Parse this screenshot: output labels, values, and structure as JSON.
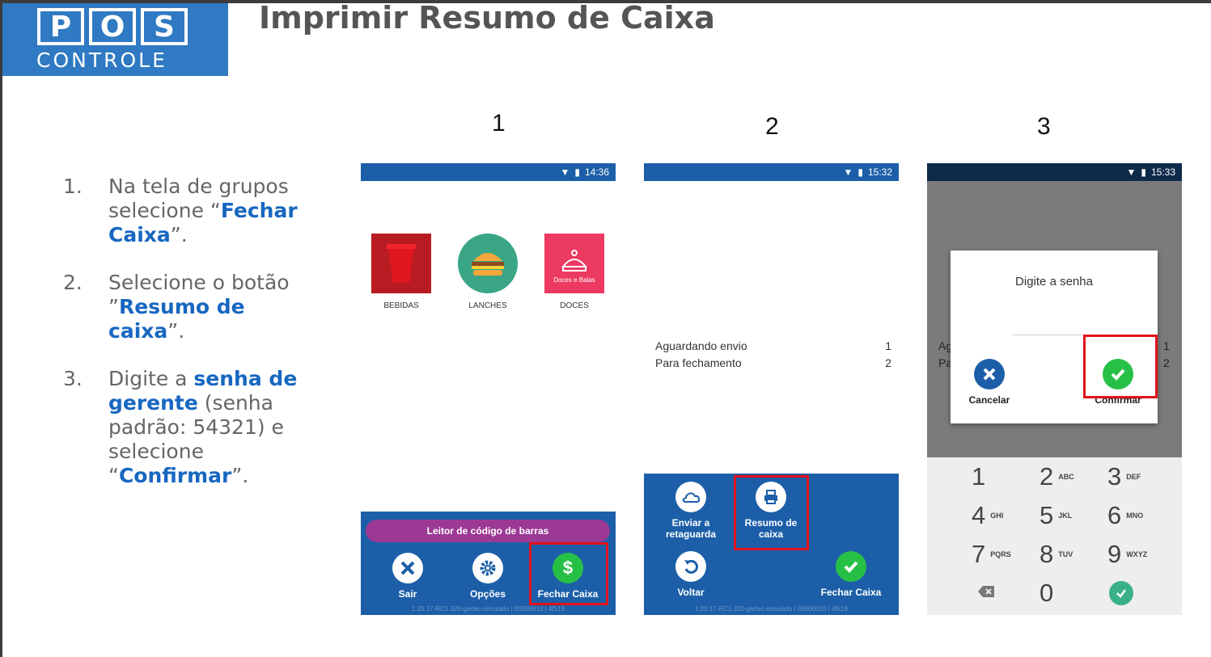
{
  "logo": {
    "letters": [
      "P",
      "O",
      "S"
    ],
    "word": "CONTROLE"
  },
  "title": "Imprimir Resumo de Caixa",
  "steps": [
    {
      "num": "1.",
      "pre": "Na tela de grupos selecione “",
      "hl1": "Fechar Caixa",
      "post": "”."
    },
    {
      "num": "2.",
      "pre": "Selecione o botão ”",
      "hl1": "Resumo de caixa",
      "post": "”."
    },
    {
      "num": "3.",
      "pre": "Digite a ",
      "hl1": "senha de gerente",
      "mid": " (senha padrão: 54321) e selecione “",
      "hl2": "Confirmar",
      "post": "”."
    }
  ],
  "columns": [
    "1",
    "2",
    "3"
  ],
  "screen1": {
    "time": "14:36",
    "groups": [
      {
        "label": "BEBIDAS"
      },
      {
        "label": "LANCHES"
      },
      {
        "label": "DOCES",
        "tile_text": "Doces e Balas"
      }
    ],
    "barcode": "Leitor de código de barras",
    "buttons": [
      "Sair",
      "Opções",
      "Fechar Caixa"
    ],
    "version": "1.20.17-RC1.320-gertec-simulado | 00000010 | 4f519"
  },
  "screen2": {
    "time": "15:32",
    "rows": [
      {
        "label": "Aguardando envio",
        "value": "1"
      },
      {
        "label": "Para fechamento",
        "value": "2"
      }
    ],
    "buttons": {
      "send": "Enviar a retaguarda",
      "summary": "Resumo de caixa",
      "back": "Voltar",
      "close": "Fechar Caixa"
    },
    "version": "1.20.17-RC1.320-gertec-simulado | 00000010 | 4f519"
  },
  "screen3": {
    "time": "15:33",
    "bg_rows": [
      {
        "label": "Ag",
        "value": "1"
      },
      {
        "label": "Pa",
        "value": "2"
      }
    ],
    "dialog_title": "Digite a senha",
    "cancel": "Cancelar",
    "confirm": "Confirmar",
    "keys": [
      {
        "n": "1",
        "l": ""
      },
      {
        "n": "2",
        "l": "ABC"
      },
      {
        "n": "3",
        "l": "DEF"
      },
      {
        "n": "4",
        "l": "GHI"
      },
      {
        "n": "5",
        "l": "JKL"
      },
      {
        "n": "6",
        "l": "MNO"
      },
      {
        "n": "7",
        "l": "PQRS"
      },
      {
        "n": "8",
        "l": "TUV"
      },
      {
        "n": "9",
        "l": "WXYZ"
      },
      {
        "n": "0",
        "l": ""
      }
    ]
  },
  "colors": {
    "brand": "#2f7ac2",
    "highlight": "#1767c0",
    "appbar": "#1c5fa8",
    "red": "#e2121a",
    "green": "#27c047"
  }
}
